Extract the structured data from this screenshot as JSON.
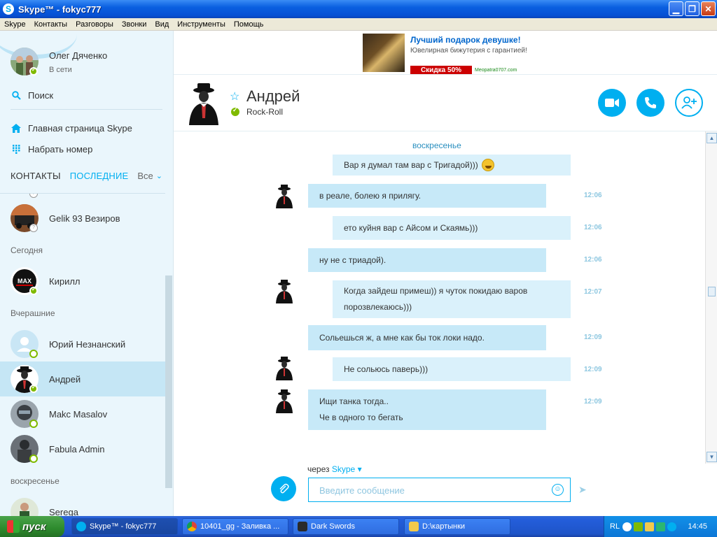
{
  "window": {
    "title": "Skype™ - fokyc777",
    "app_icon": "S"
  },
  "menu": [
    "Skype",
    "Контакты",
    "Разговоры",
    "Звонки",
    "Вид",
    "Инструменты",
    "Помощь"
  ],
  "profile": {
    "name": "Олег Дяченко",
    "status": "В сети"
  },
  "sidebar_nav": {
    "search": "Поиск",
    "home": "Главная страница Skype",
    "dial": "Набрать номер"
  },
  "tabs": {
    "contacts": "КОНТАКТЫ",
    "recent": "ПОСЛЕДНИЕ",
    "filter": "Все"
  },
  "contacts": [
    {
      "name": "Gelik 93 Везиров",
      "status": "unknown"
    },
    {
      "section": "Сегодня"
    },
    {
      "name": "Кирилл",
      "status": "online"
    },
    {
      "section": "Вчерашние"
    },
    {
      "name": "Юрий Незнанский",
      "status": "offline"
    },
    {
      "name": "Андрей",
      "status": "online",
      "selected": true
    },
    {
      "name": "Makc Masalov",
      "status": "offline"
    },
    {
      "name": "Fabula Admin",
      "status": "offline"
    },
    {
      "section": "воскресенье"
    },
    {
      "name": "Serega",
      "status": "online"
    }
  ],
  "ad": {
    "title": "Лучший подарок девушке!",
    "description": "Ювелирная бижутерия с гарантией!",
    "sale": "Скидка 50%",
    "site": "Meopatra0707.com"
  },
  "chat": {
    "contact_name": "Андрей",
    "mood": "Rock-Roll",
    "day_label": "воскресенье",
    "messages": [
      {
        "text": "Вар я думал там вар с Тригадой)))",
        "mine": true,
        "time": "",
        "emoji": true
      },
      {
        "text": "в реале, болею я прилягу.",
        "mine": false,
        "time": "12:06"
      },
      {
        "text": "ето куйня вар с Айсом и Скаямь)))",
        "mine": true,
        "time": "12:06"
      },
      {
        "text": "ну не с триадой).",
        "mine": false,
        "time": "12:06"
      },
      {
        "text": "Когда зайдеш примеш)) я чуток покидаю варов",
        "text2": "порозвлекаюсь)))",
        "mine": true,
        "time": "12:07"
      },
      {
        "text": "Сольешься ж, а мне как бы ток локи надо.",
        "mine": false,
        "time": "12:09"
      },
      {
        "text": "Не сольюсь паверь)))",
        "mine": true,
        "time": "12:09"
      },
      {
        "text": "Ищи танка тогда..",
        "text2": "Че в одного то бегать",
        "mine": false,
        "time": "12:09"
      }
    ]
  },
  "compose": {
    "via": "через",
    "via_service": "Skype",
    "placeholder": "Введите сообщение"
  },
  "taskbar": {
    "start": "пуск",
    "tasks": [
      {
        "label": "Skype™ - fokyc777",
        "active": true
      },
      {
        "label": "10401_gg - Заливка ..."
      },
      {
        "label": "Dark Swords"
      },
      {
        "label": "D:\\картынки"
      }
    ],
    "lang": "RL",
    "clock": "14:45"
  },
  "colors": {
    "accent": "#00aff0",
    "online": "#7fba00",
    "bubble_in": "#c7e9f8",
    "bubble_out": "#daf1fb"
  }
}
